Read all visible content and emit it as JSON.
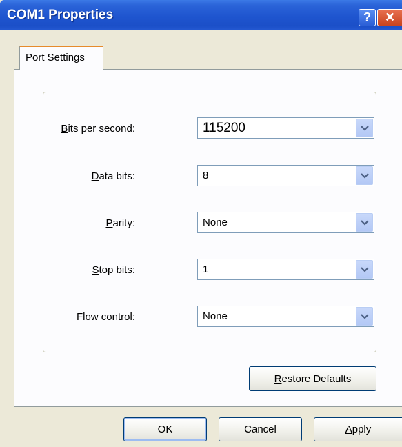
{
  "window": {
    "title": "COM1 Properties",
    "help_glyph": "?",
    "close_glyph": "✕"
  },
  "tabs": [
    {
      "label": "Port Settings",
      "selected": true
    }
  ],
  "fields": [
    {
      "label_hotkey": "B",
      "label_rest": "its per second:",
      "value": "115200"
    },
    {
      "label_hotkey": "D",
      "label_rest": "ata bits:",
      "value": "8"
    },
    {
      "label_hotkey": "P",
      "label_rest": "arity:",
      "value": "None"
    },
    {
      "label_hotkey": "S",
      "label_rest": "top bits:",
      "value": "1"
    },
    {
      "label_hotkey": "F",
      "label_rest": "low control:",
      "value": "None"
    }
  ],
  "restore_defaults": {
    "hotkey": "R",
    "rest": "estore Defaults"
  },
  "buttons": {
    "ok": "OK",
    "cancel": "Cancel",
    "apply_hotkey": "A",
    "apply_rest": "pply"
  },
  "colors": {
    "titlebar": "#1f55cf",
    "dialog_bg": "#ece9d8",
    "tab_accent": "#e68b2c"
  },
  "icons": {
    "help": "help-icon",
    "close": "close-icon",
    "dropdown": "chevron-down-icon"
  }
}
